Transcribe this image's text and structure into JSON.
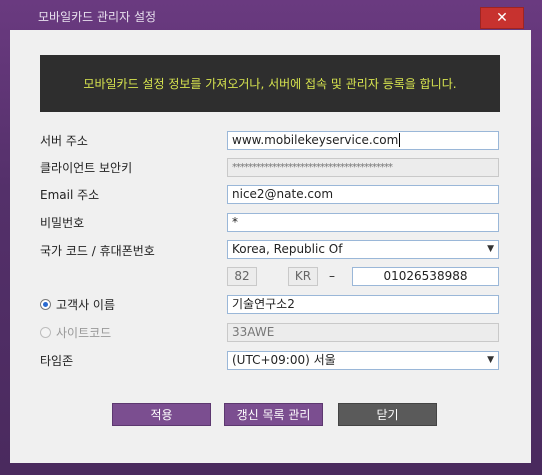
{
  "window": {
    "title": "모바일카드 관리자 설정",
    "close_glyph": "✕"
  },
  "banner": {
    "text": "모바일카드 설정 정보를 가져오거나, 서버에 접속 및 관리자 등록을 합니다."
  },
  "form": {
    "server_label": "서버 주소",
    "server_value": "www.mobilekeyservice.com",
    "client_key_label": "클라이언트 보안키",
    "client_key_value": "****************************************",
    "email_label": "Email 주소",
    "email_value": "nice2@nate.com",
    "password_label": "비밀번호",
    "password_value": "*",
    "country_label": "국가 코드 / 휴대폰번호",
    "country_value": "Korea, Republic Of",
    "country_code": "82",
    "country_abbr": "KR",
    "phone_separator": "–",
    "phone_value": "01026538988",
    "carrier_label": "고객사 이름",
    "carrier_value": "기술연구소2",
    "site_label": "사이트코드",
    "site_value": "33AWE",
    "timezone_label": "타임존",
    "timezone_value": "(UTC+09:00) 서울"
  },
  "buttons": {
    "apply": "적용",
    "renew": "갱신 목록 관리",
    "close": "닫기"
  },
  "icons": {
    "dropdown": "chevron-down-icon",
    "close": "close-icon"
  },
  "colors": {
    "frame": "#5b2d6e",
    "banner_bg": "#2e2e2e",
    "banner_text": "#d7e44f",
    "button_purple": "#7b4e90",
    "button_gray": "#5a5a5a",
    "close_red": "#c7322f"
  }
}
